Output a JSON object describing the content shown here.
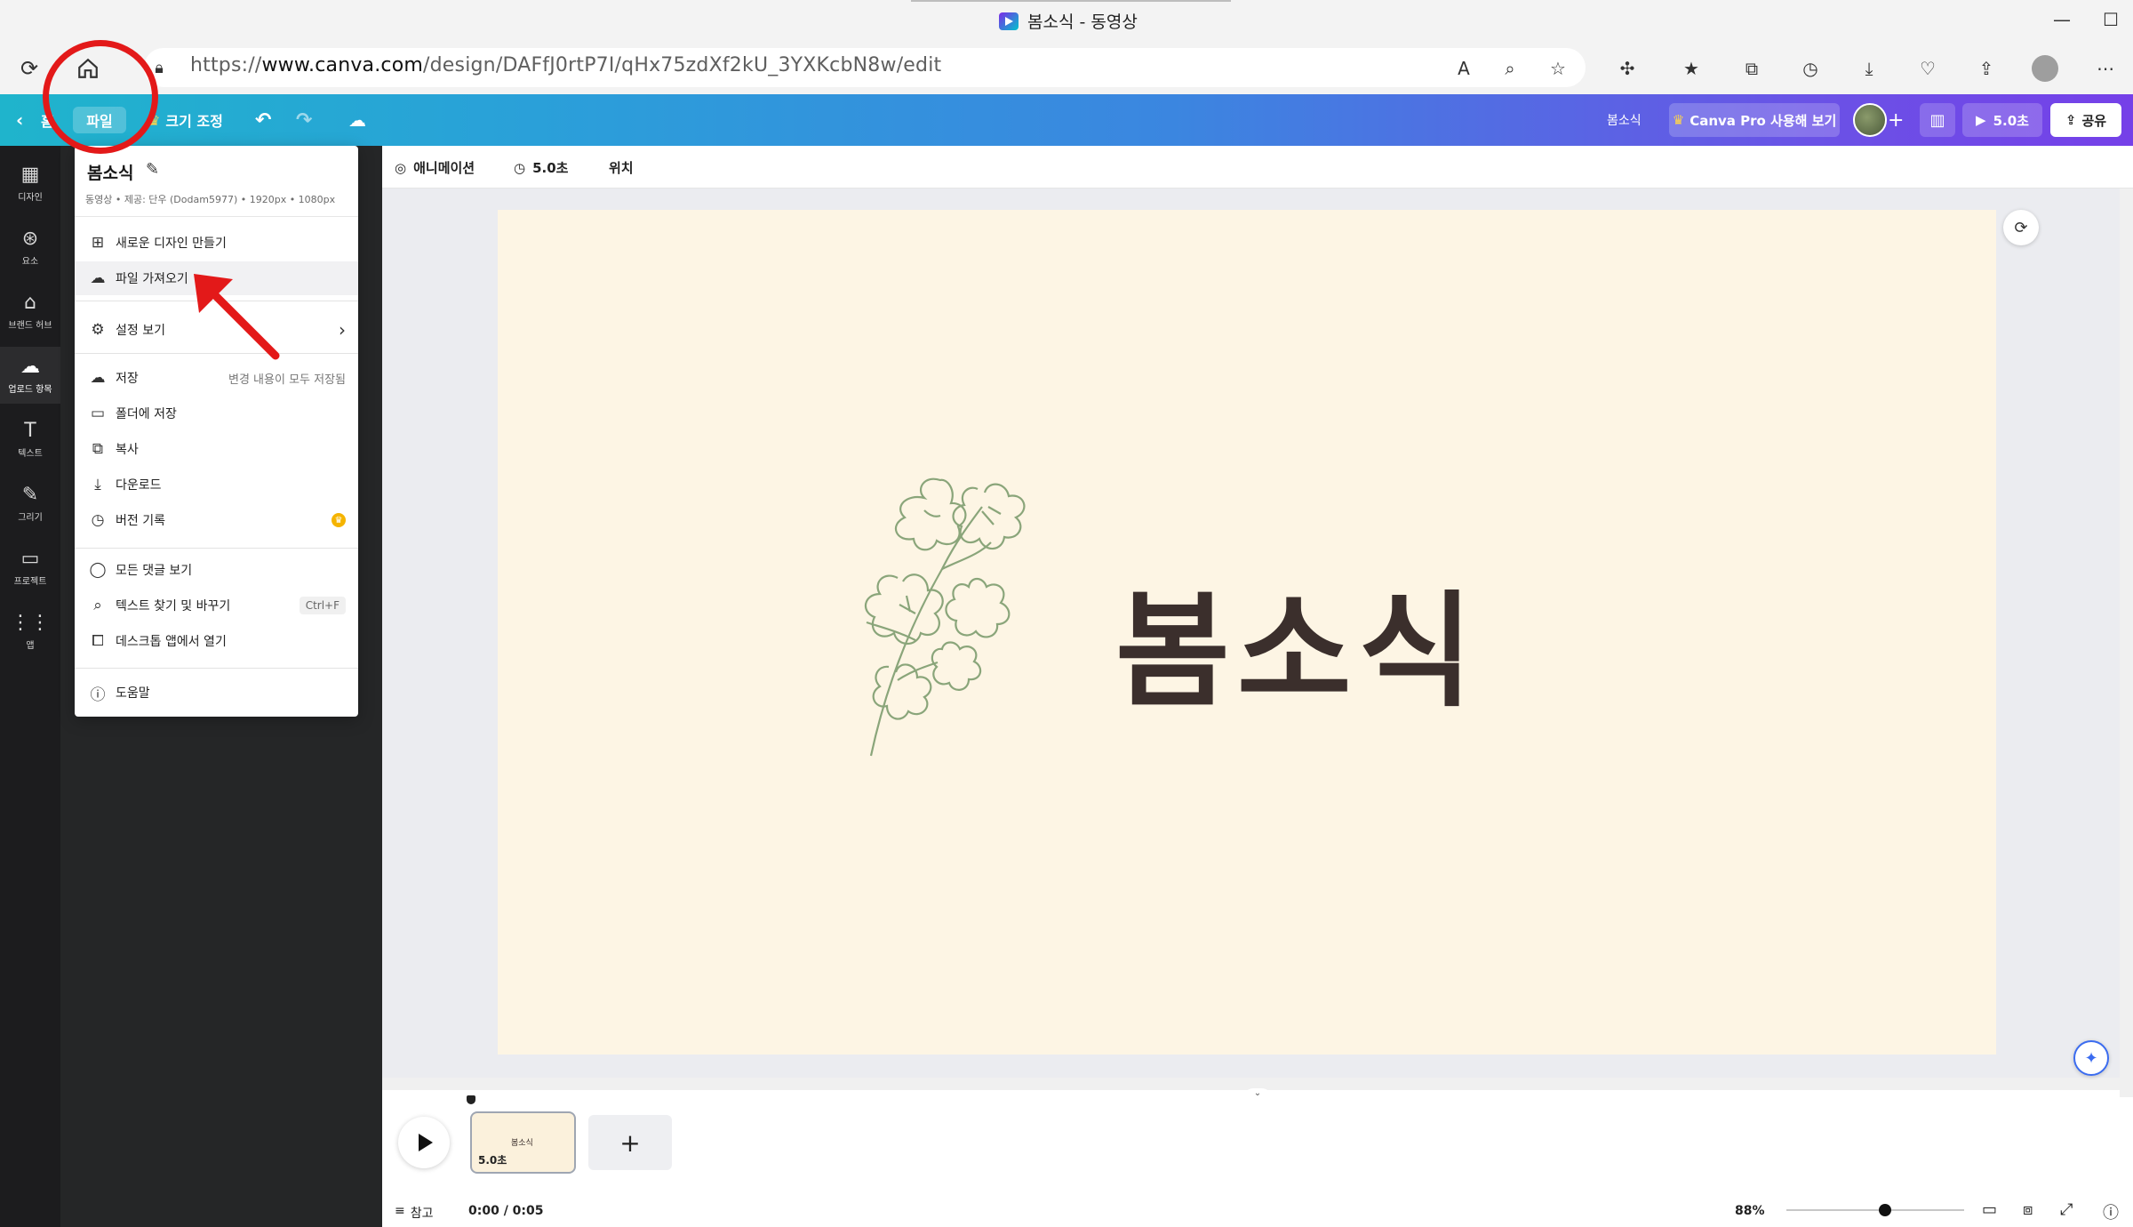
{
  "window": {
    "title": "봄소식 - 동영상",
    "minimize": "—",
    "maximize": "☐"
  },
  "browser": {
    "url_prefix": "https://",
    "url_domain": "www.canva.com",
    "url_path": "/design/DAFfJ0rtP7I/qHx75zdXf2kU_3YXKcbN8w/edit"
  },
  "topbar": {
    "home_partial": "홈",
    "file": "파일",
    "resize": "크기 조정",
    "design_name": "봄소식",
    "pro": "Canva Pro 사용해 보기",
    "play": "5.0초",
    "share": "공유"
  },
  "rail": [
    {
      "icon": "▦",
      "label": "디자인"
    },
    {
      "icon": "⊛",
      "label": "요소"
    },
    {
      "icon": "⌂",
      "label": "브랜드 허브"
    },
    {
      "icon": "☁",
      "label": "업로드 항목"
    },
    {
      "icon": "T",
      "label": "텍스트"
    },
    {
      "icon": "✎",
      "label": "그리기"
    },
    {
      "icon": "▭",
      "label": "프로젝트"
    },
    {
      "icon": "⋮⋮",
      "label": "앱"
    }
  ],
  "menu": {
    "title": "봄소식",
    "subtitle": "동영상 • 제공: 단우 (Dodam5977) • 1920px • 1080px",
    "items": {
      "new_design": "새로운 디자인 만들기",
      "import": "파일 가져오기",
      "settings": "설정 보기",
      "save": "저장",
      "save_status": "변경 내용이 모두 저장됨",
      "save_folder": "폴더에 저장",
      "copy": "복사",
      "download": "다운로드",
      "version": "버전 기록",
      "comments": "모든 댓글 보기",
      "find": "텍스트 찾기 및 바꾸기",
      "find_shortcut": "Ctrl+F",
      "desktop": "데스크톱 앱에서 열기",
      "help": "도움말"
    }
  },
  "editor": {
    "animation": "애니메이션",
    "duration": "5.0초",
    "position": "위치",
    "canvas_title": "봄소식"
  },
  "timeline": {
    "clip_text": "봄소식",
    "clip_duration": "5.0초"
  },
  "footer": {
    "notes": "참고",
    "time": "0:00 / 0:05",
    "zoom": "88%"
  },
  "colors": {
    "annotation": "#e31919",
    "canvas_bg": "#fdf5e4",
    "flower_line": "#8aa57a",
    "title_text": "#3b2f2c"
  }
}
